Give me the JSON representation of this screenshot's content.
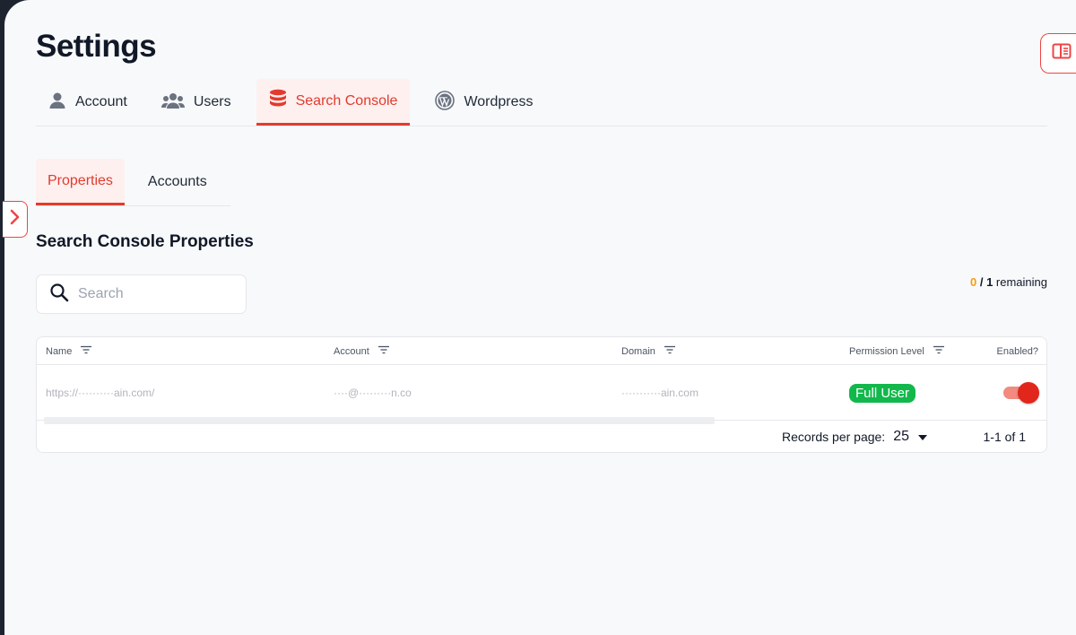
{
  "page": {
    "title": "Settings"
  },
  "main_tabs": [
    {
      "label": "Account",
      "icon": "user-icon",
      "active": false
    },
    {
      "label": "Users",
      "icon": "users-icon",
      "active": false
    },
    {
      "label": "Search Console",
      "icon": "database-icon",
      "active": true
    },
    {
      "label": "Wordpress",
      "icon": "wordpress-icon",
      "active": false
    }
  ],
  "sub_tabs": [
    {
      "label": "Properties",
      "active": true
    },
    {
      "label": "Accounts",
      "active": false
    }
  ],
  "section": {
    "title": "Search Console Properties"
  },
  "search": {
    "placeholder": "Search",
    "value": ""
  },
  "quota": {
    "used": "0",
    "separator": " / ",
    "total": "1",
    "suffix": " remaining"
  },
  "table": {
    "columns": [
      {
        "key": "name",
        "label": "Name"
      },
      {
        "key": "account",
        "label": "Account"
      },
      {
        "key": "domain",
        "label": "Domain"
      },
      {
        "key": "permission",
        "label": "Permission Level"
      },
      {
        "key": "enabled",
        "label": "Enabled?"
      }
    ],
    "rows": [
      {
        "name": "https://··········ain.com/",
        "account": "····@·········n.co",
        "domain": "···········ain.com",
        "permission": "Full User",
        "enabled": true
      }
    ],
    "footer": {
      "records_label": "Records per page:",
      "records_value": "25",
      "range": "1-1 of 1"
    }
  },
  "colors": {
    "accent": "#e23b2e",
    "badge_green": "#12b84b",
    "quota_used": "#f59e0b"
  }
}
